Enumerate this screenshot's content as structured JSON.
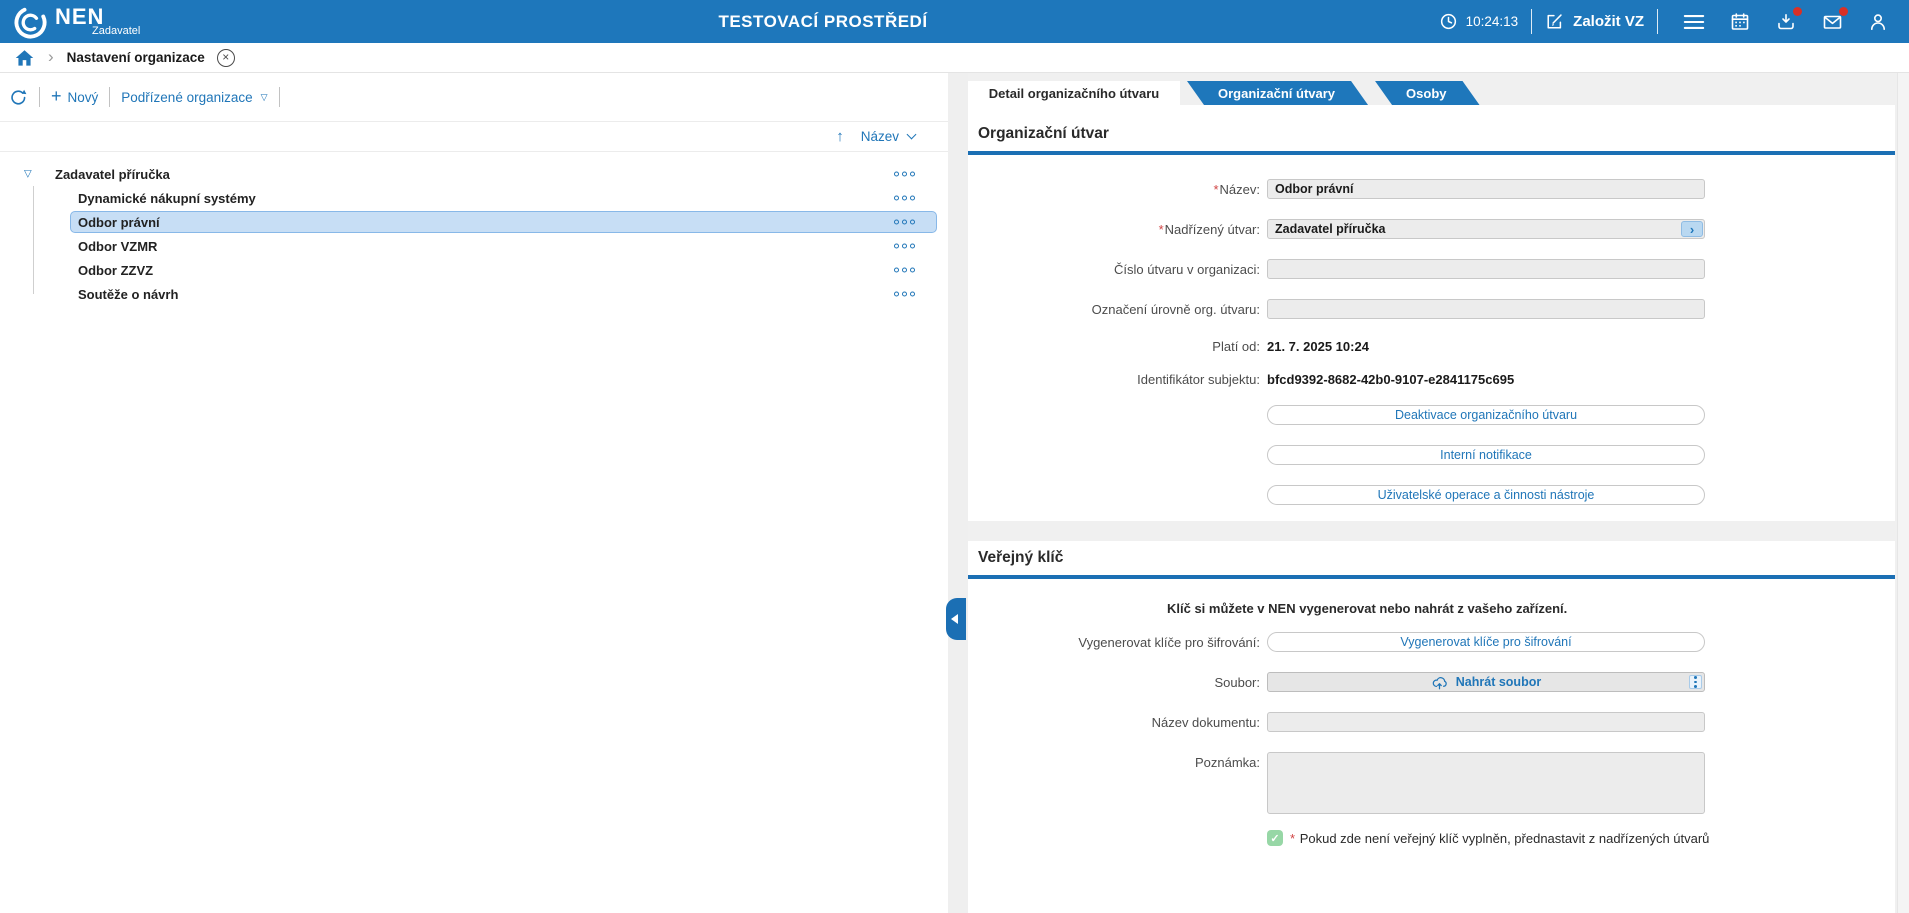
{
  "icons": {
    "plus": "+",
    "triangle_down": "▽",
    "arrow_up": "↑",
    "breadcrumb_chevron": "›",
    "close": "×",
    "check": "✓",
    "field_chevron": "›"
  },
  "required_mark": "*",
  "header": {
    "app_name": "NEN",
    "app_subtitle": "Zadavatel",
    "environment_title": "TESTOVACÍ PROSTŘEDÍ",
    "time": "10:24:13",
    "create_vz_label": "Založit VZ"
  },
  "breadcrumb": {
    "page_title": "Nastavení organizace"
  },
  "tree_panel": {
    "toolbar": {
      "new_label": "Nový",
      "scope_label": "Podřízené organizace"
    },
    "sort_label": "Název",
    "items": [
      {
        "label": "Zadavatel příručka",
        "level": 0,
        "selected": false
      },
      {
        "label": "Dynamické nákupní systémy",
        "level": 1,
        "selected": false
      },
      {
        "label": "Odbor právní",
        "level": 1,
        "selected": true
      },
      {
        "label": "Odbor VZMR",
        "level": 1,
        "selected": false
      },
      {
        "label": "Odbor ZZVZ",
        "level": 1,
        "selected": false
      },
      {
        "label": "Soutěže o návrh",
        "level": 1,
        "selected": false
      }
    ]
  },
  "tabs": [
    {
      "label": "Detail organizačního útvaru",
      "active": true
    },
    {
      "label": "Organizační útvary",
      "active": false
    },
    {
      "label": "Osoby",
      "active": false
    }
  ],
  "detail_section": {
    "title": "Organizační útvar",
    "fields": {
      "nazev": {
        "label": "Název:",
        "value": "Odbor právní",
        "required": true
      },
      "nadrizeny_utvar": {
        "label": "Nadřízený útvar:",
        "value": "Zadavatel příručka",
        "required": true
      },
      "cislo_utvaru": {
        "label": "Číslo útvaru v organizaci:",
        "value": ""
      },
      "oznaceni_urovne": {
        "label": "Označení úrovně org. útvaru:",
        "value": ""
      },
      "plati_od": {
        "label": "Platí od:",
        "value": "21. 7. 2025 10:24"
      },
      "identifikator": {
        "label": "Identifikátor subjektu:",
        "value": "bfcd9392-8682-42b0-9107-e2841175c695"
      }
    },
    "buttons": [
      "Deaktivace organizačního útvaru",
      "Interní notifikace",
      "Uživatelské operace a činnosti nástroje"
    ]
  },
  "key_section": {
    "title": "Veřejný klíč",
    "hint": "Klíč si můžete v NEN vygenerovat nebo nahrát z vašeho zařízení.",
    "generate_label": "Vygenerovat klíče pro šifrování:",
    "generate_button": "Vygenerovat klíče pro šifrování",
    "file_label": "Soubor:",
    "upload_button": "Nahrát soubor",
    "document_name_label": "Název dokumentu:",
    "document_name_value": "",
    "note_label": "Poznámka:",
    "note_value": "",
    "checkbox_checked": true,
    "checkbox_text": "Pokud zde není veřejný klíč vyplněn, přednastavit z nadřízených útvarů"
  },
  "colors": {
    "header_blue": "#1e77bb",
    "accent_blue": "#2076b8",
    "section_underline_blue": "#1b6fb4",
    "selected_row_bg": "#c7def5",
    "badge_red": "#d93025",
    "checkbox_green": "#97d7a6",
    "input_bg": "#ececec"
  }
}
